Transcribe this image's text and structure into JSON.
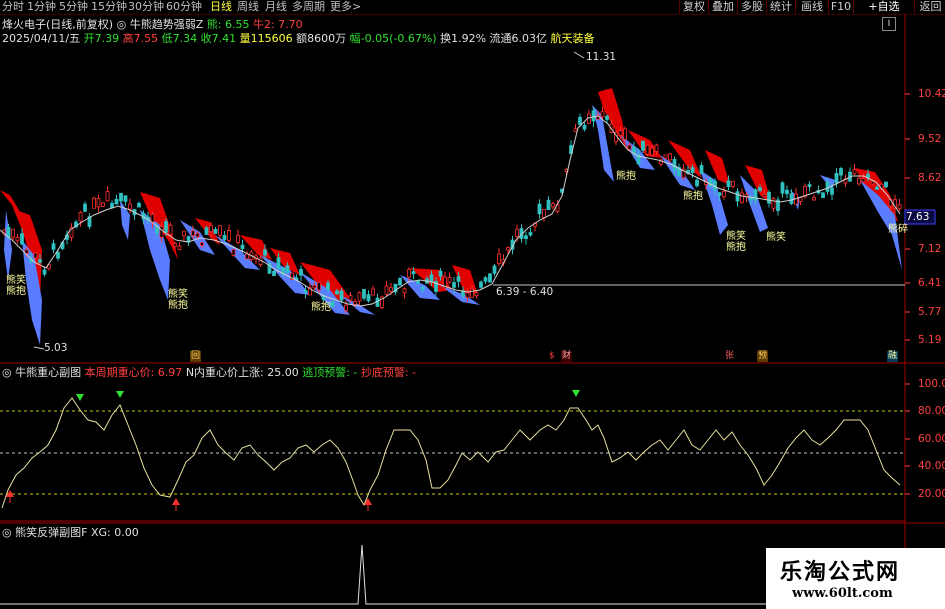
{
  "topbar": {
    "periods": [
      "分时",
      "1分钟",
      "5分钟",
      "15分钟",
      "30分钟",
      "60分钟",
      "日线",
      "周线",
      "月线",
      "多周期",
      "更多>"
    ],
    "active_period": "日线",
    "right_buttons": [
      "复权",
      "叠加",
      "多股",
      "统计",
      "画线",
      "F10",
      "+自选",
      "返回"
    ]
  },
  "header": {
    "title": "烽火电子(日线,前复权)",
    "indicator_name": "牛熊趋势强弱Z",
    "indicator_bear_label": "熊: 6.55",
    "indicator_bull_label": "牛2: 7.70",
    "right_badge": "I",
    "date": "2025/04/11/五",
    "open_label": "开7.39",
    "high_label": "高7.55",
    "low_label": "低7.34",
    "close_label": "收7.41",
    "volume_label": "量115606",
    "amount_label": "额8600万",
    "change_label": "幅-0.05(-0.67%)",
    "turnover_label": "换1.92%",
    "float_label": "流通6.03亿",
    "sector_label": "航天装备"
  },
  "price_axis": [
    "10.42",
    "9.52",
    "8.62",
    "7.63",
    "7.12",
    "6.41",
    "5.77",
    "5.19"
  ],
  "current_price_tag": "7.63",
  "annotations": {
    "high_marker": "11.31",
    "low_marker": "5.03",
    "range_label": "6.39 - 6.40"
  },
  "pattern_labels": {
    "bear_hug": "熊抱",
    "bear_smile": "熊笑",
    "bear_hug_alt": "熊碎"
  },
  "event_markers": [
    "回",
    "$",
    "财",
    "张",
    "预",
    "融"
  ],
  "sub1": {
    "title": "牛熊重心副图",
    "heavy_label": "本周期重心价: 6.97",
    "n_label": "N内重心价上涨: 25.00",
    "escape_label": "逃顶预警: -",
    "bottom_label": "抄底预警: -",
    "axis": [
      "100.0",
      "80.00",
      "60.00",
      "40.00",
      "20.00"
    ]
  },
  "sub2": {
    "title": "熊笑反弹副图F",
    "xg_label": "XG: 0.00"
  },
  "watermark": {
    "line1": "乐淘公式网",
    "line2": "www.60lt.com"
  },
  "colors": {
    "bull_fill": "#e00000",
    "bear_fill": "#6080ff",
    "up_candle": "#ff3030",
    "down_candle": "#30c0c0",
    "ma_line": "#d0d0d0",
    "sub_line": "#e8e0a0",
    "grid_yellow": "#c8c800",
    "grid_white": "#c8c8c8"
  }
}
